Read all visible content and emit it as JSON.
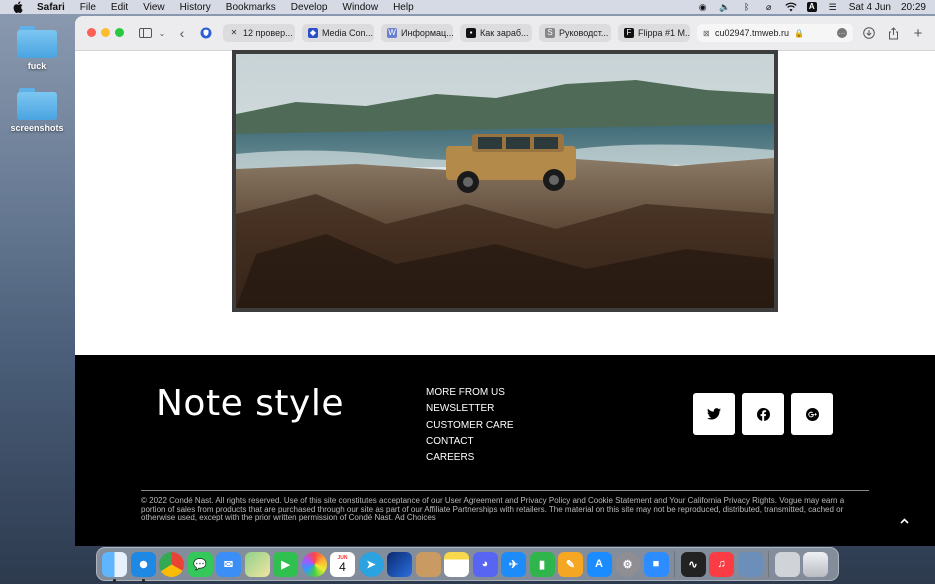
{
  "menubar": {
    "app": "Safari",
    "items": [
      "File",
      "Edit",
      "View",
      "History",
      "Bookmarks",
      "Develop",
      "Window",
      "Help"
    ],
    "date": "Sat 4 Jun",
    "time": "20:29"
  },
  "desktop": {
    "items": [
      {
        "label": "fuck"
      },
      {
        "label": "screenshots"
      }
    ]
  },
  "browser": {
    "tabs": [
      {
        "label": "12 провер...",
        "icon": "tools-icon",
        "color": "#333333"
      },
      {
        "label": "Media Con...",
        "icon": "media-icon",
        "color": "#2b4fc9"
      },
      {
        "label": "Информац...",
        "icon": "wiki-icon",
        "color": "#6a7fd0"
      },
      {
        "label": "Как зараб...",
        "icon": "vc-icon",
        "color": "#111111"
      },
      {
        "label": "Руководст...",
        "icon": "s-icon",
        "color": "#888888"
      },
      {
        "label": "Flippa #1 M...",
        "icon": "flippa-icon",
        "color": "#111111"
      },
      {
        "label": "cu02947.tmweb.ru",
        "icon": "close-icon",
        "color": "#666666",
        "active": true
      }
    ]
  },
  "footer": {
    "brand": "Note style",
    "links": [
      "MORE FROM US",
      "NEWSLETTER",
      "CUSTOMER CARE",
      "CONTACT",
      "CAREERS"
    ],
    "social": [
      "twitter-icon",
      "facebook-icon",
      "google-plus-icon"
    ],
    "legal": "© 2022 Condé Nast. All rights reserved. Use of this site constitutes acceptance of our User Agreement and Privacy Policy and Cookie Statement and Your California Privacy Rights. Vogue may earn a portion of sales from products that are purchased through our site as part of our Affiliate Partnerships with retailers. The material on this site may not be reproduced, distributed, transmitted, cached or otherwise used, except with the prior written permission of Condé Nast. Ad Choices"
  },
  "dock": {
    "calendar_month": "JUN",
    "calendar_day": "4",
    "apps": [
      "finder",
      "safari",
      "chrome",
      "messages",
      "mail",
      "maps",
      "facetime",
      "photos",
      "calendar",
      "telegram",
      "vpn",
      "contacts",
      "notes",
      "discord",
      "testflight",
      "numbers",
      "pages",
      "app-store",
      "system-preferences",
      "zoom",
      "activity-monitor",
      "music",
      "preview",
      "image-capture",
      "trash"
    ]
  }
}
